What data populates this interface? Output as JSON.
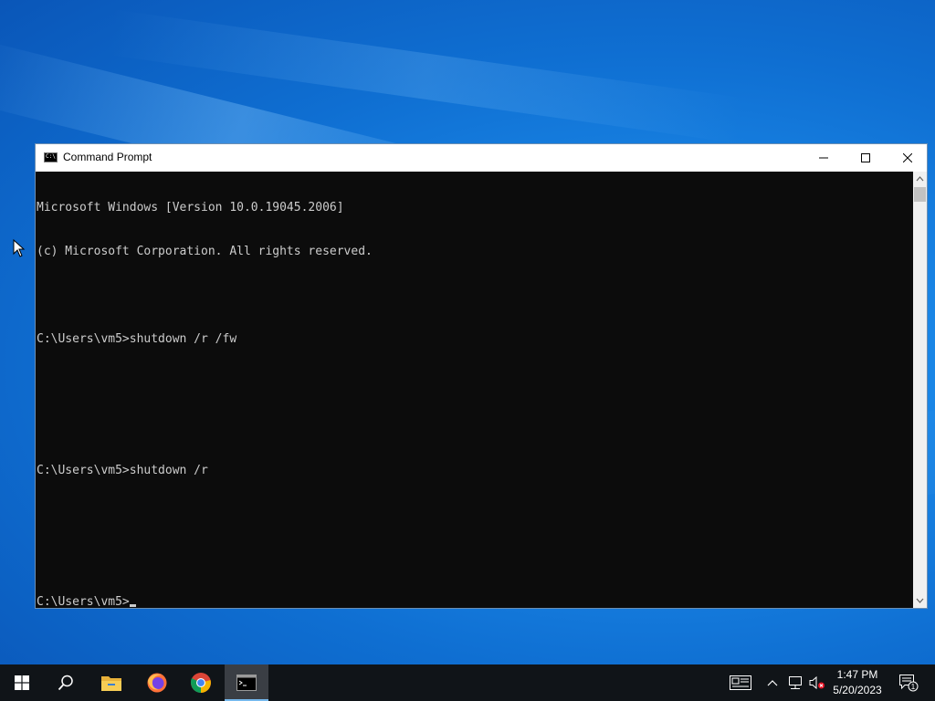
{
  "window": {
    "title": "Command Prompt",
    "icon": "cmd-icon",
    "icon_glyph": "C:\\",
    "controls": [
      "minimize-icon",
      "maximize-icon",
      "close-icon"
    ]
  },
  "console": {
    "lines": [
      "Microsoft Windows [Version 10.0.19045.2006]",
      "(c) Microsoft Corporation. All rights reserved.",
      "",
      "C:\\Users\\vm5>shutdown /r /fw",
      "",
      "",
      "C:\\Users\\vm5>shutdown /r",
      "",
      "",
      "C:\\Users\\vm5>"
    ]
  },
  "taskbar": {
    "items": [
      "start-icon",
      "search-icon",
      "file-explorer-icon",
      "firefox-icon",
      "chrome-icon",
      "cmd-icon"
    ],
    "active_item": "cmd-icon",
    "tray_icons": [
      "news-widget-icon",
      "chevron-up-icon",
      "network-icon",
      "volume-muted-icon"
    ],
    "clock": {
      "time": "1:47 PM",
      "date": "5/20/2023"
    },
    "notification_count": "1"
  },
  "colors": {
    "console_bg": "#0c0c0c",
    "console_text": "#cccccc",
    "taskbar_bg": "#101418",
    "desktop_blue": "#1a86e6"
  }
}
